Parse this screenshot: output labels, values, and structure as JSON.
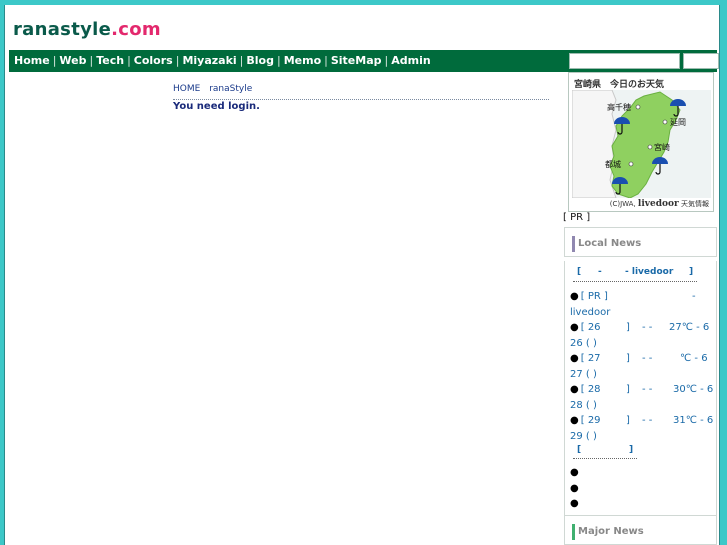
{
  "site": {
    "name": "ranastyle",
    "tld": ".com"
  },
  "nav": {
    "items": [
      "Home",
      "Web",
      "Tech",
      "Colors",
      "Miyazaki",
      "Blog",
      "Memo",
      "SiteMap",
      "Admin"
    ],
    "separator": "|"
  },
  "search": {
    "value": "",
    "button_label": ""
  },
  "breadcrumb": [
    "HOME",
    "ranaStyle"
  ],
  "main": {
    "message": "You need login."
  },
  "weather": {
    "title": "宮崎県　今日のお天気",
    "cities": [
      "高千穂",
      "延岡",
      "宮崎",
      "都城"
    ],
    "credit_prefix": "(C)JWA,",
    "credit_brand": "livedoor",
    "credit_suffix": "天気情報",
    "colors": {
      "land": "#8fd060",
      "sea": "#eef3f3",
      "umbrella": "#1a4fb0"
    }
  },
  "pr_label": "[ PR ]",
  "local_news": {
    "title": "Local News",
    "bar_color": "#9088b0",
    "header": {
      "open": "[",
      "dash": "-",
      "source": "- livedoor",
      "close": "]"
    },
    "pr_item": {
      "label": "[ PR ]",
      "dash": "-",
      "source": "livedoor"
    },
    "forecasts": [
      {
        "date": "[ 26",
        "close": "]",
        "dashes": "-   -",
        "temp": "27℃ - 6",
        "line2": "26 ( )"
      },
      {
        "date": "[ 27",
        "close": "]",
        "dashes": "-    -",
        "temp": "℃ - 6",
        "line2": "27 ( )"
      },
      {
        "date": "[ 28",
        "close": "]",
        "dashes": "-    -",
        "temp": "30℃ - 6",
        "line2": "28 ( )"
      },
      {
        "date": "[ 29",
        "close": "]",
        "dashes": "-    -",
        "temp": "31℃ - 6",
        "line2": "29 ( )"
      }
    ],
    "sub_header": {
      "open": "[",
      "close": "]"
    },
    "empty_bullets": 3
  },
  "major_news": {
    "title": "Major News",
    "bar_color": "#40b070"
  }
}
